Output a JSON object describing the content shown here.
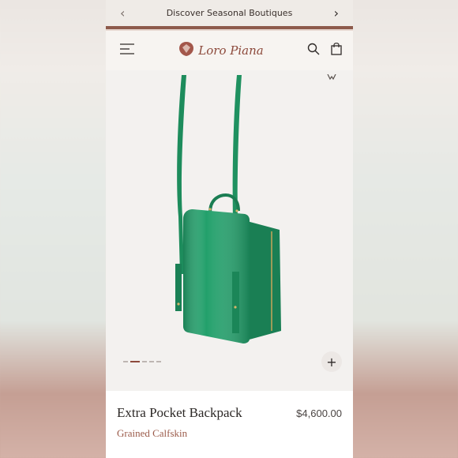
{
  "promo": {
    "text": "Discover Seasonal Boutiques",
    "prev_icon": "chevron-left-icon",
    "next_icon": "chevron-right-icon"
  },
  "header": {
    "menu_icon": "hamburger-menu-icon",
    "brand": "Loro Piana",
    "search_icon": "search-icon",
    "bag_icon": "shopping-bag-icon",
    "brand_color": "#8d4a3c"
  },
  "gallery": {
    "image_count": 5,
    "active_index": 1,
    "zoom_icon": "plus-icon",
    "product_color": "#1f8a5a"
  },
  "product": {
    "name": "Extra Pocket Backpack",
    "price": "$4,600.00",
    "material": "Grained Calfskin"
  }
}
